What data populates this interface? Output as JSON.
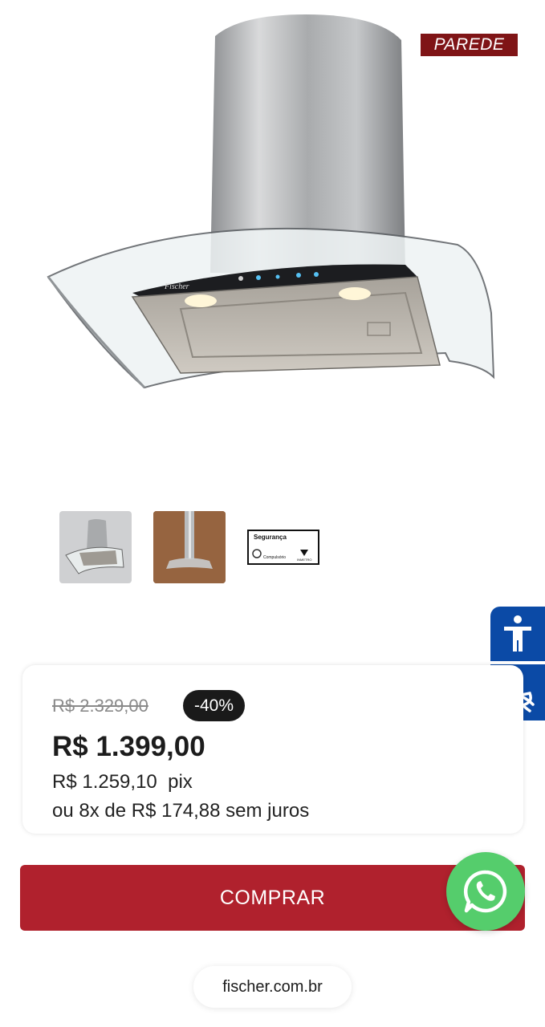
{
  "product": {
    "mount_badge": "PAREDE",
    "hood_brand_mark": "Fischer",
    "thumbnails": [
      {
        "name": "thumb-product-front"
      },
      {
        "name": "thumb-product-installed"
      },
      {
        "name": "thumb-safety-seal",
        "title": "Segurança",
        "left_text": "Compulsório",
        "right_text": "INMETRO"
      }
    ]
  },
  "pricing": {
    "old_price": "R$ 2.329,00",
    "discount": "-40%",
    "price": "R$ 1.399,00",
    "pix_price": "R$ 1.259,10  pix",
    "installments": "ou 8x de R$ 174,88 sem juros"
  },
  "actions": {
    "buy_label": "COMPRAR"
  },
  "accessibility": {
    "buttons": [
      "accessibility-icon",
      "sign-language-icon"
    ],
    "color": "#0b4aa6"
  },
  "browser": {
    "url": "fischer.com.br"
  },
  "colors": {
    "buy_button": "#b0212d",
    "badge": "#7f1416",
    "whatsapp": "#55cd6c"
  }
}
